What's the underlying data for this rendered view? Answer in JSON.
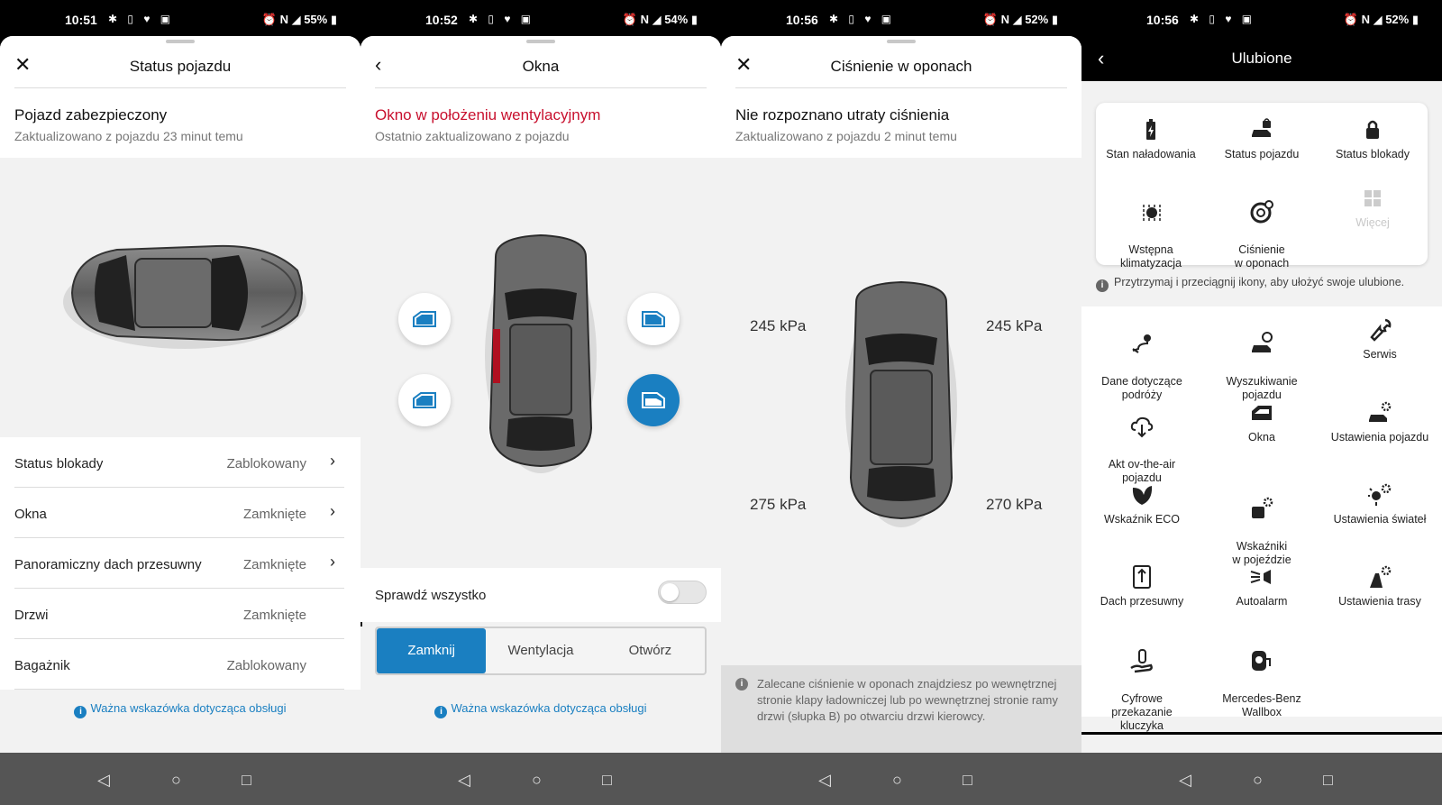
{
  "screens": [
    {
      "status": {
        "time": "10:51",
        "battery": "55%"
      },
      "nav": {
        "title": "Status pojazdu",
        "button": "close"
      },
      "header": {
        "title": "Pojazd zabezpieczony",
        "subtitle": "Zaktualizowano z pojazdu 23 minut temu"
      },
      "rows": [
        {
          "label": "Status blokady",
          "value": "Zablokowany",
          "chevron": true
        },
        {
          "label": "Okna",
          "value": "Zamknięte",
          "chevron": true
        },
        {
          "label": "Panoramiczny dach przesuwny",
          "value": "Zamknięte",
          "chevron": true
        },
        {
          "label": "Drzwi",
          "value": "Zamknięte",
          "chevron": false
        },
        {
          "label": "Bagażnik",
          "value": "Zablokowany",
          "chevron": false
        }
      ],
      "footer_link": "Ważna wskazówka dotycząca obsługi"
    },
    {
      "status": {
        "time": "10:52",
        "battery": "54%"
      },
      "nav": {
        "title": "Okna",
        "button": "back"
      },
      "header": {
        "title": "Okno w położeniu wentylacyjnym",
        "subtitle": "Ostatnio zaktualizowano z pojazdu"
      },
      "toggle_label": "Sprawdź wszystko",
      "segments": [
        "Zamknij",
        "Wentylacja",
        "Otwórz"
      ],
      "selected_segment": "Zamknij",
      "footer_link": "Ważna wskazówka dotycząca obsługi"
    },
    {
      "status": {
        "time": "10:56",
        "battery": "52%"
      },
      "nav": {
        "title": "Ciśnienie w oponach",
        "button": "close"
      },
      "header": {
        "title": "Nie rozpoznano utraty ciśnienia",
        "subtitle": "Zaktualizowano z pojazdu 2 minut temu"
      },
      "pressures": {
        "front_left": "245 kPa",
        "front_right": "245 kPa",
        "rear_left": "275 kPa",
        "rear_right": "270 kPa"
      },
      "note": "Zalecane ciśnienie w oponach znajdziesz po wewnętrznej stronie klapy ładowniczej lub po wewnętrznej stronie ramy drzwi (słupka B) po otwarciu drzwi kierowcy."
    },
    {
      "status": {
        "time": "10:56",
        "battery": "52%"
      },
      "nav": {
        "title": "Ulubione",
        "button": "back"
      },
      "favorites": [
        {
          "label": "Stan naładowania",
          "icon": "battery-icon"
        },
        {
          "label": "Status pojazdu",
          "icon": "car-lock-icon"
        },
        {
          "label": "Status blokady",
          "icon": "lock-icon"
        },
        {
          "label": "Wstępna\nklimatyzacja",
          "icon": "climate-icon"
        },
        {
          "label": "Ciśnienie\nw oponach",
          "icon": "tire-icon"
        },
        {
          "label": "Więcej",
          "icon": "grid-icon"
        }
      ],
      "hint": "Przytrzymaj i przeciągnij ikony, aby ułożyć swoje ulubione.",
      "items": [
        {
          "label": "Dane dotyczące\npodróży",
          "icon": "route-icon"
        },
        {
          "label": "Wyszukiwanie\npojazdu",
          "icon": "car-pin-icon"
        },
        {
          "label": "Serwis",
          "icon": "wrench-icon"
        },
        {
          "label": "Akt ov-the-air\npojazdu",
          "icon": "cloud-download-icon"
        },
        {
          "label": "Okna",
          "icon": "window-icon"
        },
        {
          "label": "Ustawienia pojazdu",
          "icon": "car-gear-icon"
        },
        {
          "label": "Wskaźnik ECO",
          "icon": "leaf-icon"
        },
        {
          "label": "Wskaźniki\nw pojeździe",
          "icon": "gauge-gear-icon"
        },
        {
          "label": "Ustawienia świateł",
          "icon": "light-gear-icon"
        },
        {
          "label": "Dach przesuwny",
          "icon": "sunroof-icon"
        },
        {
          "label": "Autoalarm",
          "icon": "horn-icon"
        },
        {
          "label": "Ustawienia trasy",
          "icon": "road-gear-icon"
        },
        {
          "label": "Cyfrowe\nprzekazanie\nkluczyka",
          "icon": "key-hand-icon"
        },
        {
          "label": "Mercedes-Benz\nWallbox",
          "icon": "wallbox-icon"
        }
      ]
    }
  ]
}
